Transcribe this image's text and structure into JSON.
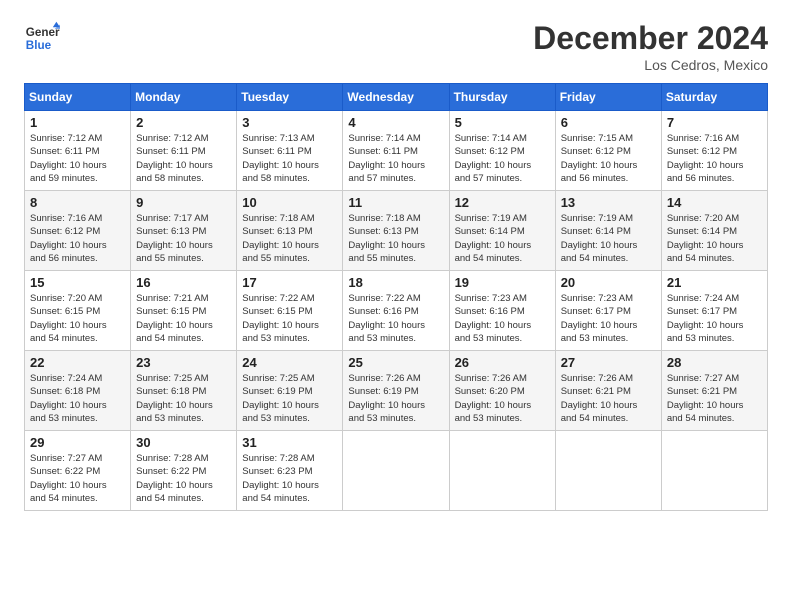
{
  "logo": {
    "line1": "General",
    "line2": "Blue"
  },
  "title": "December 2024",
  "location": "Los Cedros, Mexico",
  "days_of_week": [
    "Sunday",
    "Monday",
    "Tuesday",
    "Wednesday",
    "Thursday",
    "Friday",
    "Saturday"
  ],
  "weeks": [
    [
      {
        "day": "1",
        "sunrise": "7:12 AM",
        "sunset": "6:11 PM",
        "daylight": "10 hours and 59 minutes."
      },
      {
        "day": "2",
        "sunrise": "7:12 AM",
        "sunset": "6:11 PM",
        "daylight": "10 hours and 58 minutes."
      },
      {
        "day": "3",
        "sunrise": "7:13 AM",
        "sunset": "6:11 PM",
        "daylight": "10 hours and 58 minutes."
      },
      {
        "day": "4",
        "sunrise": "7:14 AM",
        "sunset": "6:11 PM",
        "daylight": "10 hours and 57 minutes."
      },
      {
        "day": "5",
        "sunrise": "7:14 AM",
        "sunset": "6:12 PM",
        "daylight": "10 hours and 57 minutes."
      },
      {
        "day": "6",
        "sunrise": "7:15 AM",
        "sunset": "6:12 PM",
        "daylight": "10 hours and 56 minutes."
      },
      {
        "day": "7",
        "sunrise": "7:16 AM",
        "sunset": "6:12 PM",
        "daylight": "10 hours and 56 minutes."
      }
    ],
    [
      {
        "day": "8",
        "sunrise": "7:16 AM",
        "sunset": "6:12 PM",
        "daylight": "10 hours and 56 minutes."
      },
      {
        "day": "9",
        "sunrise": "7:17 AM",
        "sunset": "6:13 PM",
        "daylight": "10 hours and 55 minutes."
      },
      {
        "day": "10",
        "sunrise": "7:18 AM",
        "sunset": "6:13 PM",
        "daylight": "10 hours and 55 minutes."
      },
      {
        "day": "11",
        "sunrise": "7:18 AM",
        "sunset": "6:13 PM",
        "daylight": "10 hours and 55 minutes."
      },
      {
        "day": "12",
        "sunrise": "7:19 AM",
        "sunset": "6:14 PM",
        "daylight": "10 hours and 54 minutes."
      },
      {
        "day": "13",
        "sunrise": "7:19 AM",
        "sunset": "6:14 PM",
        "daylight": "10 hours and 54 minutes."
      },
      {
        "day": "14",
        "sunrise": "7:20 AM",
        "sunset": "6:14 PM",
        "daylight": "10 hours and 54 minutes."
      }
    ],
    [
      {
        "day": "15",
        "sunrise": "7:20 AM",
        "sunset": "6:15 PM",
        "daylight": "10 hours and 54 minutes."
      },
      {
        "day": "16",
        "sunrise": "7:21 AM",
        "sunset": "6:15 PM",
        "daylight": "10 hours and 54 minutes."
      },
      {
        "day": "17",
        "sunrise": "7:22 AM",
        "sunset": "6:15 PM",
        "daylight": "10 hours and 53 minutes."
      },
      {
        "day": "18",
        "sunrise": "7:22 AM",
        "sunset": "6:16 PM",
        "daylight": "10 hours and 53 minutes."
      },
      {
        "day": "19",
        "sunrise": "7:23 AM",
        "sunset": "6:16 PM",
        "daylight": "10 hours and 53 minutes."
      },
      {
        "day": "20",
        "sunrise": "7:23 AM",
        "sunset": "6:17 PM",
        "daylight": "10 hours and 53 minutes."
      },
      {
        "day": "21",
        "sunrise": "7:24 AM",
        "sunset": "6:17 PM",
        "daylight": "10 hours and 53 minutes."
      }
    ],
    [
      {
        "day": "22",
        "sunrise": "7:24 AM",
        "sunset": "6:18 PM",
        "daylight": "10 hours and 53 minutes."
      },
      {
        "day": "23",
        "sunrise": "7:25 AM",
        "sunset": "6:18 PM",
        "daylight": "10 hours and 53 minutes."
      },
      {
        "day": "24",
        "sunrise": "7:25 AM",
        "sunset": "6:19 PM",
        "daylight": "10 hours and 53 minutes."
      },
      {
        "day": "25",
        "sunrise": "7:26 AM",
        "sunset": "6:19 PM",
        "daylight": "10 hours and 53 minutes."
      },
      {
        "day": "26",
        "sunrise": "7:26 AM",
        "sunset": "6:20 PM",
        "daylight": "10 hours and 53 minutes."
      },
      {
        "day": "27",
        "sunrise": "7:26 AM",
        "sunset": "6:21 PM",
        "daylight": "10 hours and 54 minutes."
      },
      {
        "day": "28",
        "sunrise": "7:27 AM",
        "sunset": "6:21 PM",
        "daylight": "10 hours and 54 minutes."
      }
    ],
    [
      {
        "day": "29",
        "sunrise": "7:27 AM",
        "sunset": "6:22 PM",
        "daylight": "10 hours and 54 minutes."
      },
      {
        "day": "30",
        "sunrise": "7:28 AM",
        "sunset": "6:22 PM",
        "daylight": "10 hours and 54 minutes."
      },
      {
        "day": "31",
        "sunrise": "7:28 AM",
        "sunset": "6:23 PM",
        "daylight": "10 hours and 54 minutes."
      },
      null,
      null,
      null,
      null
    ]
  ],
  "labels": {
    "sunrise": "Sunrise:",
    "sunset": "Sunset:",
    "daylight": "Daylight:"
  }
}
